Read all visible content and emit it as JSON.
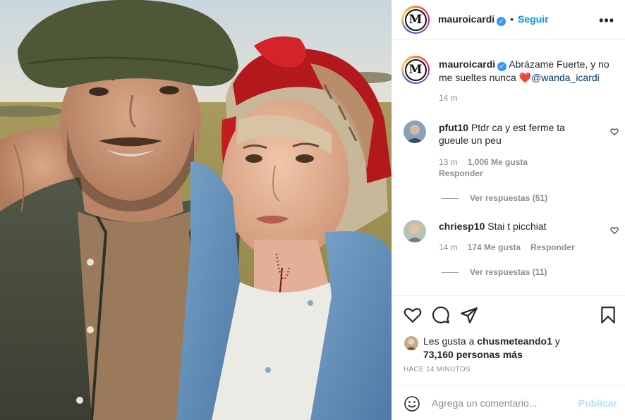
{
  "post": {
    "username": "mauroicardi",
    "avatar_letter": "M",
    "follow_label": "Seguir",
    "more_icon": "more-horizontal-icon",
    "caption": {
      "text_part1": "Abrázame Fuerte, y no me sueltes nunca ",
      "emoji": "❤️",
      "mention": "@wanda_icardi",
      "time": "14 m"
    },
    "comments": [
      {
        "username": "pfut10",
        "text": "Ptdr ca y est ferme ta gueule un peu",
        "time": "13 m",
        "likes": "1,006 Me gusta",
        "reply": "Responder",
        "view_replies": "Ver respuestas (51)"
      },
      {
        "username": "chriesp10",
        "text": "Stai t picchiat",
        "time": "14 m",
        "likes": "174 Me gusta",
        "reply": "Responder",
        "view_replies": "Ver respuestas (11)"
      }
    ],
    "likes": {
      "prefix": "Les gusta a ",
      "user": "chusmeteando1",
      "middle": " y ",
      "count": "73,160 personas más"
    },
    "posted_time": "HACE 14 MINUTOS",
    "add_comment": {
      "placeholder": "Agrega un comentario...",
      "publish_label": "Publicar"
    }
  },
  "colors": {
    "accent": "#0095f6",
    "muted": "#8e8e8e",
    "text": "#262626",
    "border": "#efefef",
    "publish_disabled": "#b2dffc"
  }
}
